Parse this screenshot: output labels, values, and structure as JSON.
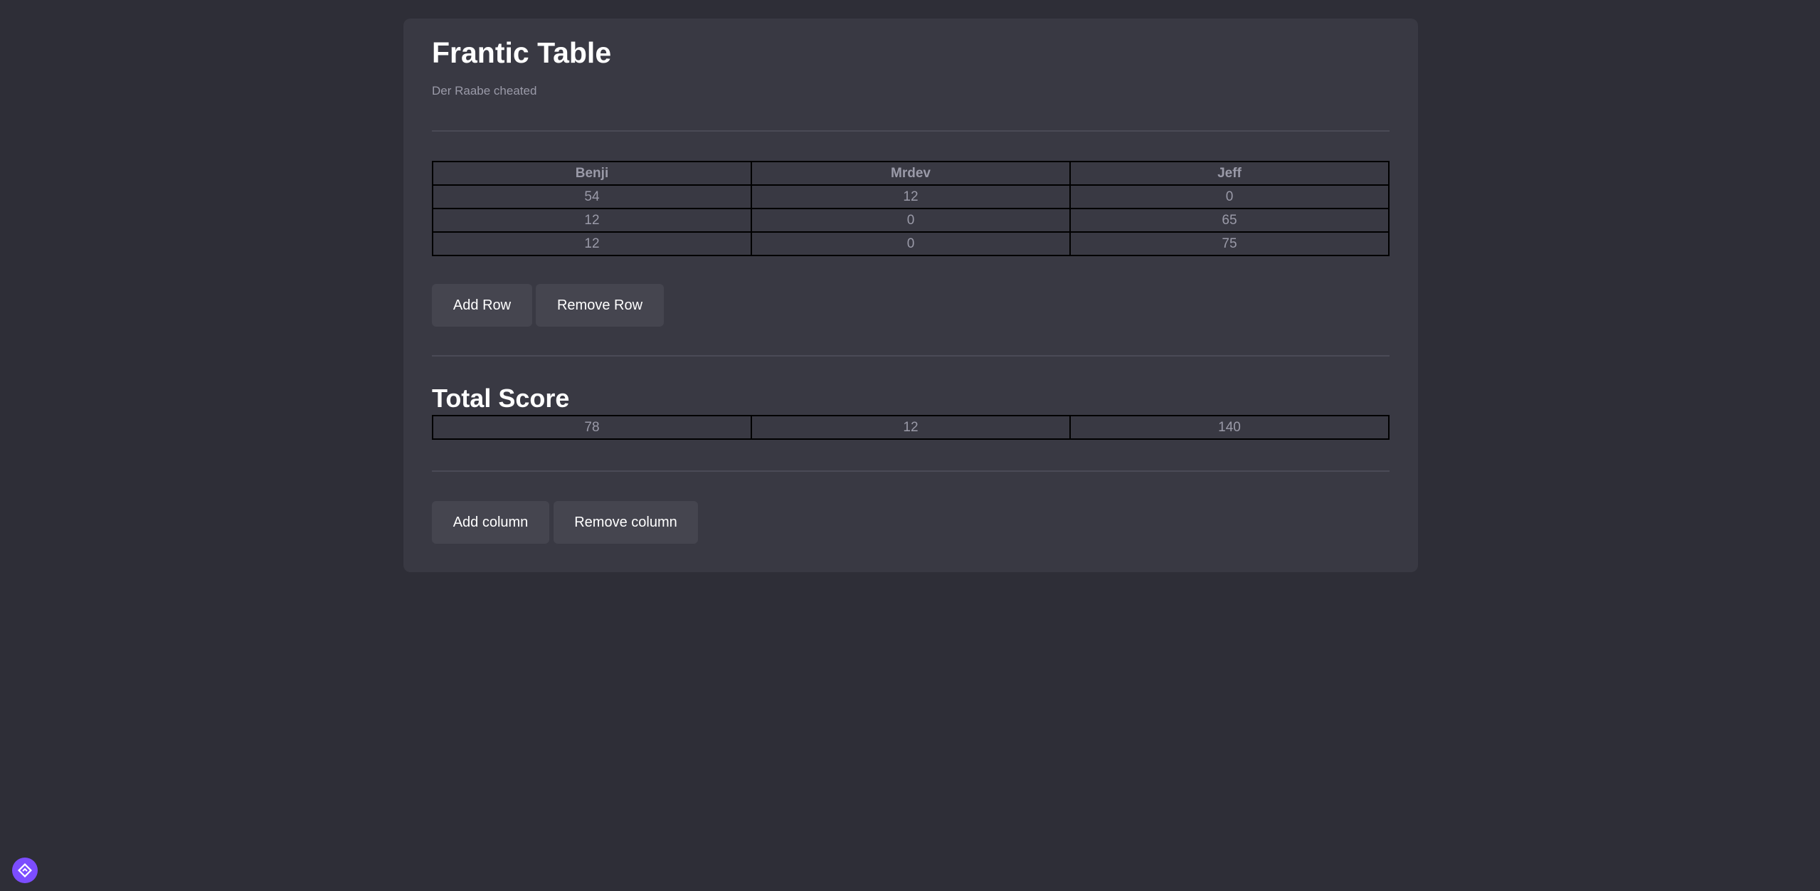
{
  "header": {
    "title": "Frantic Table",
    "subtitle": "Der Raabe cheated"
  },
  "scores_table": {
    "columns": [
      "Benji",
      "Mrdev",
      "Jeff"
    ],
    "rows": [
      [
        "54",
        "12",
        "0"
      ],
      [
        "12",
        "0",
        "65"
      ],
      [
        "12",
        "0",
        "75"
      ]
    ]
  },
  "row_actions": {
    "add_row_label": "Add Row",
    "remove_row_label": "Remove Row"
  },
  "total": {
    "heading": "Total Score",
    "values": [
      "78",
      "12",
      "140"
    ]
  },
  "column_actions": {
    "add_column_label": "Add column",
    "remove_column_label": "Remove column"
  },
  "colors": {
    "background": "#2e2e37",
    "card": "#393943",
    "button": "#45454f",
    "accent": "#7c4dff"
  },
  "icons": {
    "corner": "diamond-direction-icon"
  }
}
